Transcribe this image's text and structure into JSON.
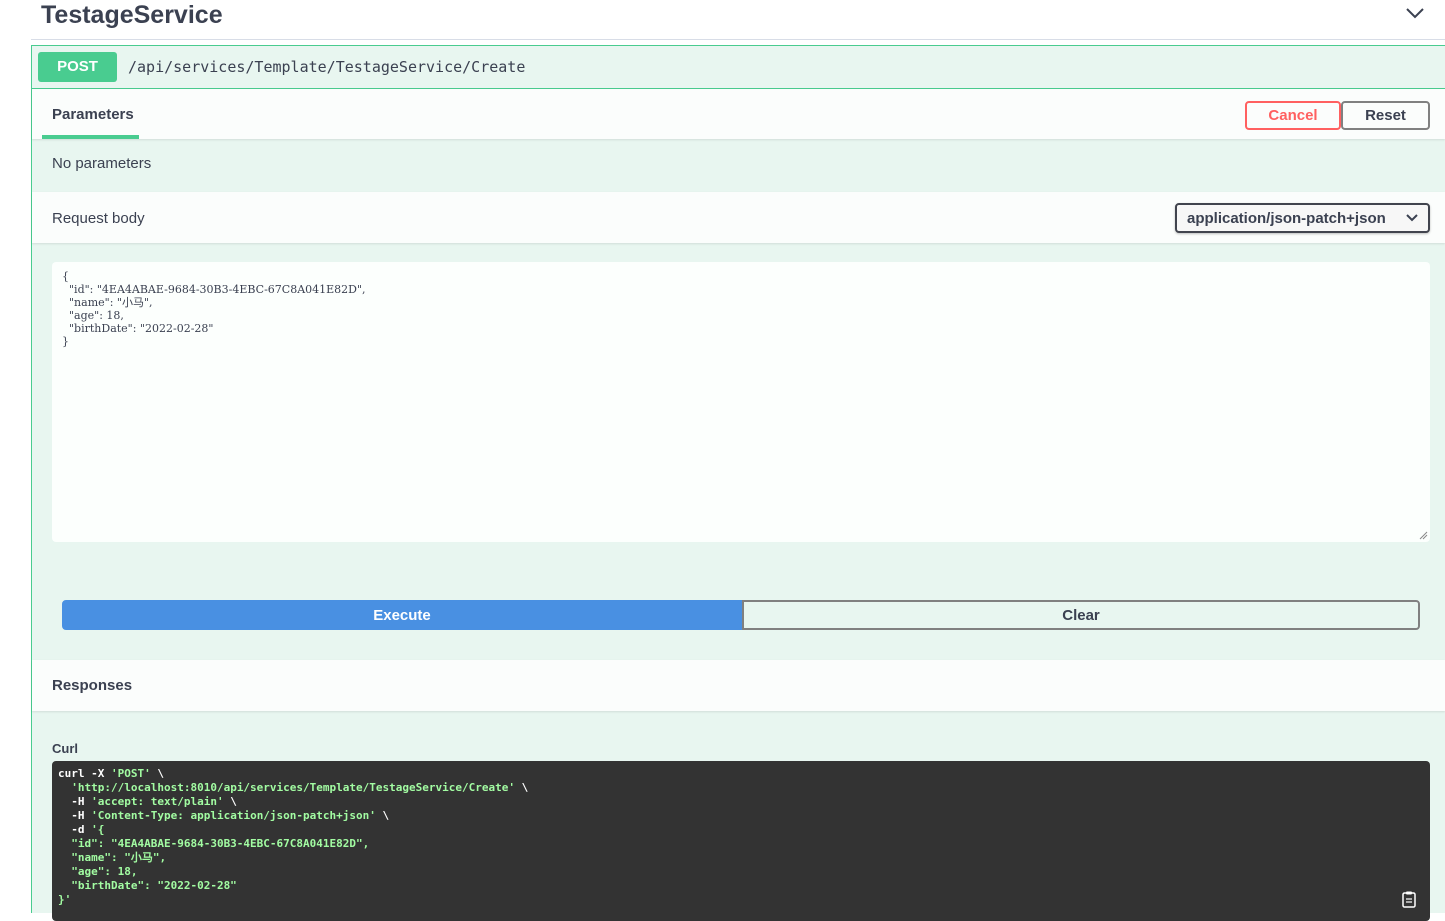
{
  "tag": {
    "title": "TestageService",
    "chevron_icon": "chevron-down-icon"
  },
  "operation": {
    "method": "POST",
    "path": "/api/services/Template/TestageService/Create",
    "color": "#49cc90"
  },
  "parameters": {
    "tab_label": "Parameters",
    "cancel_label": "Cancel",
    "reset_label": "Reset",
    "empty_text": "No parameters"
  },
  "request_body": {
    "label": "Request body",
    "content_type": "application/json-patch+json",
    "value": "{\n  \"id\": \"4EA4ABAE-9684-30B3-4EBC-67C8A041E82D\",\n  \"name\": \"小马\",\n  \"age\": 18,\n  \"birthDate\": \"2022-02-28\"\n}"
  },
  "actions": {
    "execute_label": "Execute",
    "clear_label": "Clear",
    "execute_color": "#4990e2"
  },
  "responses": {
    "label": "Responses"
  },
  "curl": {
    "label": "Curl",
    "line1": "curl -X ",
    "line1_str": "'POST'",
    "line1_end": " \\",
    "line2_str": "'http://localhost:8010/api/services/Template/TestageService/Create'",
    "line2_end": " \\",
    "line3": "  -H ",
    "line3_str": "'accept: text/plain'",
    "line3_end": " \\",
    "line4": "  -H ",
    "line4_str": "'Content-Type: application/json-patch+json'",
    "line4_end": " \\",
    "line5": "  -d ",
    "line5_str": "'{",
    "body_lines": [
      "  \"id\": \"4EA4ABAE-9684-30B3-4EBC-67C8A041E82D\",",
      "  \"name\": \"小马\",",
      "  \"age\": 18,",
      "  \"birthDate\": \"2022-02-28\""
    ],
    "last_line": "}'",
    "copy_icon": "clipboard-icon"
  }
}
